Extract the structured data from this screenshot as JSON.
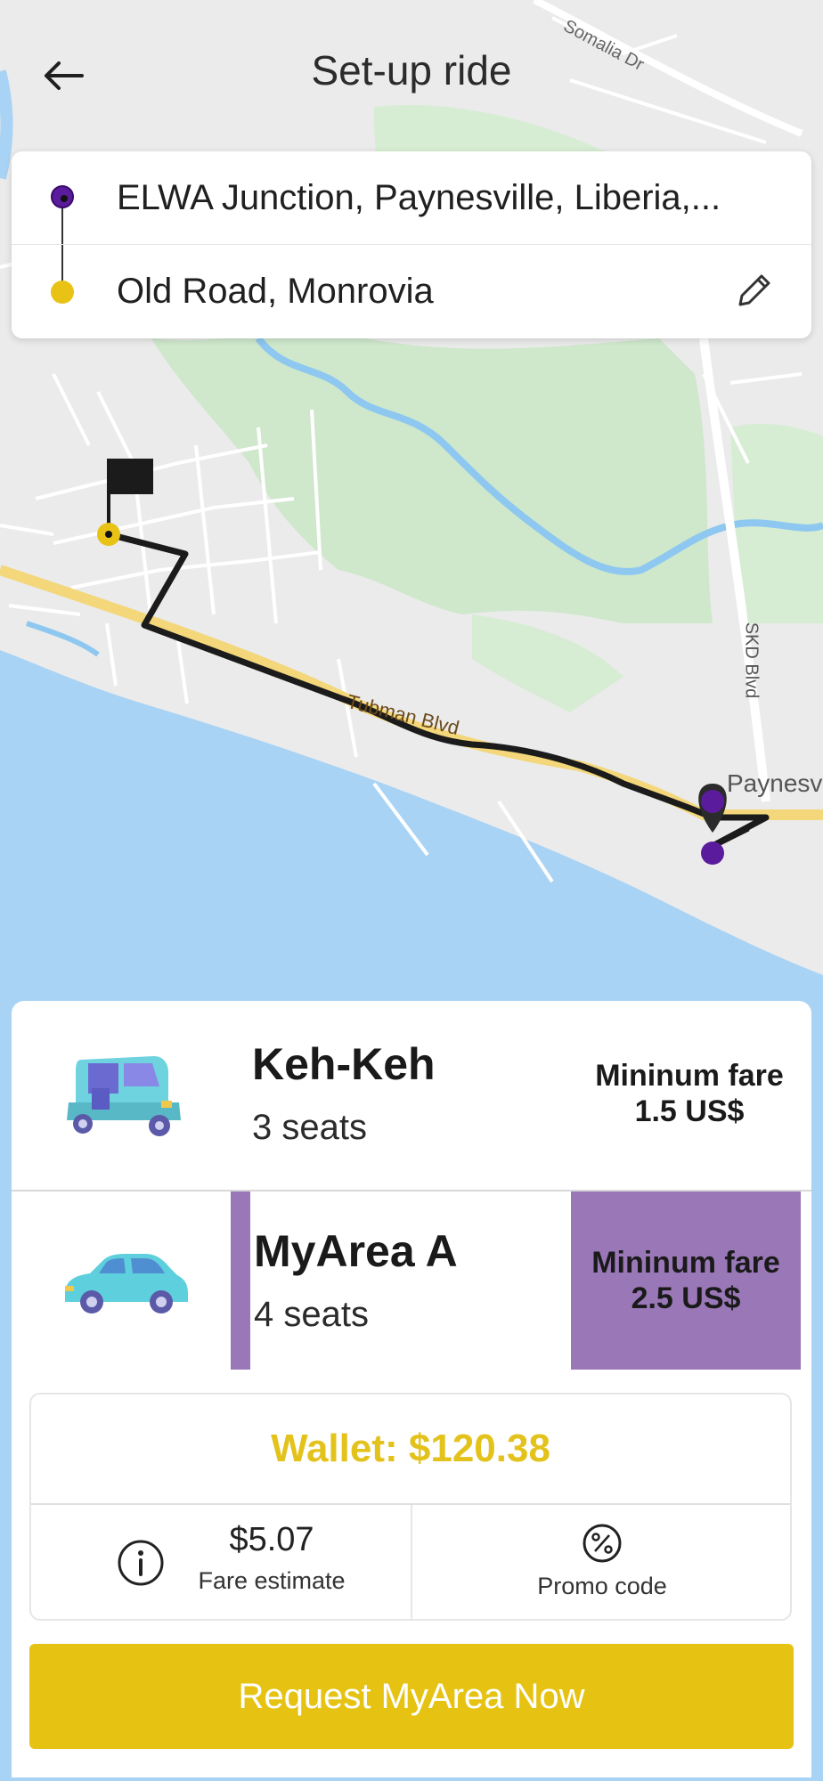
{
  "header": {
    "title": "Set-up ride",
    "back_icon": "arrow-left-icon"
  },
  "route": {
    "pickup": "ELWA Junction, Paynesville, Liberia,...",
    "dropoff": "Old Road, Monrovia",
    "pickup_color": "#5a1b9c",
    "dropoff_color": "#e8c215",
    "edit_icon": "pencil-icon"
  },
  "map": {
    "labels": {
      "road_1": "Somalia Dr",
      "road_2": "Tubman Blvd",
      "road_3": "SKD Blvd",
      "place_1": "Paynesv"
    }
  },
  "rides": [
    {
      "name": "Keh-Keh",
      "seats": "3 seats",
      "fare_line1": "Mininum fare",
      "fare_line2": "1.5 US$",
      "icon": "tuk-tuk-icon",
      "selected": false
    },
    {
      "name": "MyArea A",
      "seats": "4 seats",
      "fare_line1": "Mininum fare",
      "fare_line2": "2.5 US$",
      "icon": "car-icon",
      "selected": true
    }
  ],
  "wallet": {
    "label": "Wallet: $120.38"
  },
  "fare": {
    "value": "$5.07",
    "label": "Fare estimate",
    "icon": "info-icon"
  },
  "promo": {
    "label": "Promo code",
    "icon": "percent-icon"
  },
  "request_button": "Request MyArea Now",
  "colors": {
    "accent_yellow": "#e6c312",
    "selected_purple": "#9a78b8",
    "route_purple": "#5a1b9c"
  }
}
